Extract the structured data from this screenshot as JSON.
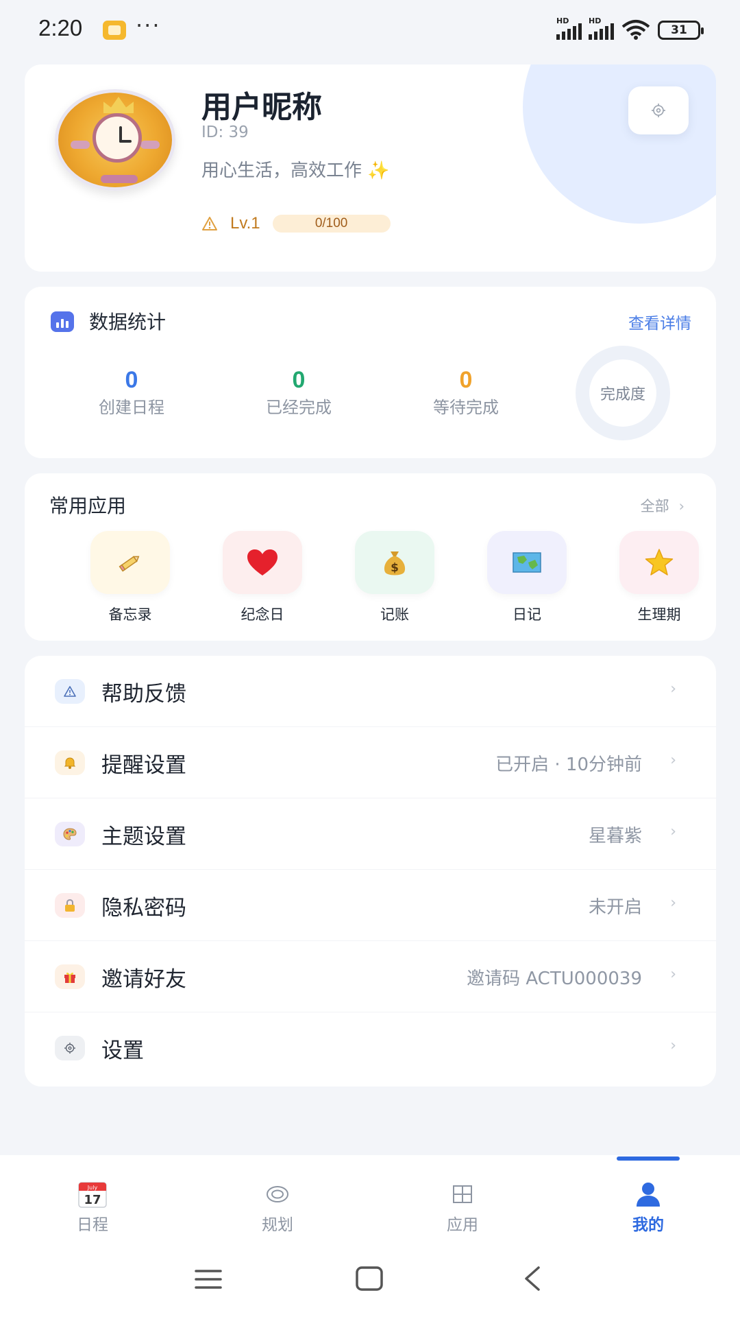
{
  "status_bar": {
    "time": "2:20",
    "dots": "···",
    "network": "HD",
    "battery": "31"
  },
  "profile": {
    "nickname": "用户昵称",
    "id": "ID: 39",
    "motto": "用心生活，高效工作",
    "motto_emoji": "✨",
    "level": "Lv.1",
    "exp": "0/100"
  },
  "stats": {
    "title": "数据统计",
    "view_detail": "查看详情",
    "items": [
      {
        "value": "0",
        "label": "创建日程",
        "color": "#3b78e7"
      },
      {
        "value": "0",
        "label": "已经完成",
        "color": "#22a870"
      },
      {
        "value": "0",
        "label": "等待完成",
        "color": "#f0a22b"
      }
    ],
    "completion_label": "完成度"
  },
  "apps": {
    "title": "常用应用",
    "all_label": "全部",
    "items": [
      {
        "label": "备忘录",
        "icon": "pencil-icon",
        "bg": "#fff8e6"
      },
      {
        "label": "纪念日",
        "icon": "heart-icon",
        "bg": "#fdeeee"
      },
      {
        "label": "记账",
        "icon": "money-bag-icon",
        "bg": "#eaf8f1"
      },
      {
        "label": "日记",
        "icon": "map-icon",
        "bg": "#f0f0fd"
      },
      {
        "label": "生理期",
        "icon": "star-icon",
        "bg": "#fdeef2"
      }
    ]
  },
  "menu": {
    "items": [
      {
        "label": "帮助反馈",
        "value": "",
        "icon": "warning-icon",
        "bg": "#e8f0fd"
      },
      {
        "label": "提醒设置",
        "value": "已开启 · 10分钟前",
        "icon": "bell-icon",
        "bg": "#fdf3e4"
      },
      {
        "label": "主题设置",
        "value": "星暮紫",
        "icon": "palette-icon",
        "bg": "#efecfb"
      },
      {
        "label": "隐私密码",
        "value": "未开启",
        "icon": "lock-icon",
        "bg": "#fdeceb"
      },
      {
        "label": "邀请好友",
        "value": "邀请码 ACTU000039",
        "icon": "gift-icon",
        "bg": "#fdf1e5"
      },
      {
        "label": "设置",
        "value": "",
        "icon": "gear-icon",
        "bg": "#eef0f3"
      }
    ]
  },
  "tabbar": {
    "items": [
      {
        "label": "日程",
        "icon": "calendar-icon",
        "active": false
      },
      {
        "label": "规划",
        "icon": "target-icon",
        "active": false
      },
      {
        "label": "应用",
        "icon": "grid-icon",
        "active": false
      },
      {
        "label": "我的",
        "icon": "user-icon",
        "active": true
      }
    ],
    "calendar_month": "July",
    "calendar_day": "17",
    "accent": "#2e6ae0"
  }
}
